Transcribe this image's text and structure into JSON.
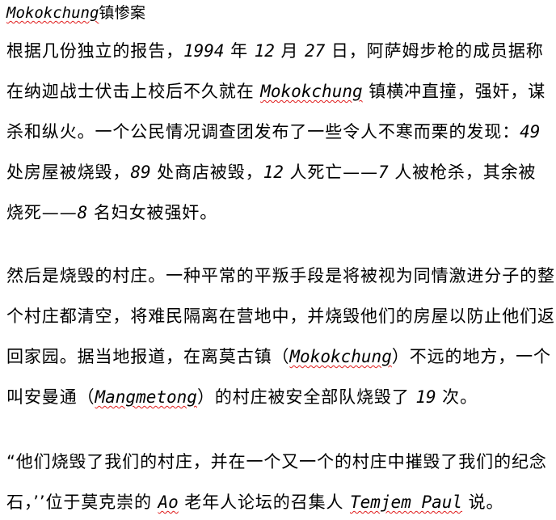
{
  "title": {
    "word": "Mokokchung",
    "rest": "镇惨案"
  },
  "p1": {
    "l1a": "根据几份独立的报告，",
    "l1b": "1994",
    "l1c": " 年 ",
    "l1d": "12",
    "l1e": " 月 ",
    "l1f": "27",
    "l1g": " 日，阿萨姆步枪的成员据称",
    "l2a": "在纳迦战士伏击上校后不久就在 ",
    "l2b": "Mokokchung",
    "l2c": " 镇横冲直撞，强奸，谋",
    "l3a": "杀和纵火。一个公民情况调查团发布了一些令人不寒而栗的发现：",
    "l3b": "49",
    "l4a": "处房屋被烧毁，",
    "l4b": "89",
    "l4c": " 处商店被毁，",
    "l4d": "12",
    "l4e": " 人死亡——",
    "l4f": "7",
    "l4g": " 人被枪杀，其余被",
    "l5a": "烧死——",
    "l5b": "8",
    "l5c": " 名妇女被强奸。"
  },
  "p2": {
    "l1": "然后是烧毁的村庄。一种平常的平叛手段是将被视为同情激进分子的整",
    "l2": "个村庄都清空，将难民隔离在营地中，并烧毁他们的房屋以防止他们返",
    "l3a": "回家园。据当地报道，在离莫古镇（",
    "l3b": "Mokokchung",
    "l3c": "）不远的地方，一个",
    "l4a": "叫安曼通（",
    "l4b": "Mangmetong",
    "l4c": "）的村庄被安全部队烧毁了 ",
    "l4d": "19",
    "l4e": " 次。"
  },
  "p3": {
    "l1": "“他们烧毁了我们的村庄，并在一个又一个的村庄中摧毁了我们的纪念",
    "l2a": "石，’’位于莫克崇的 ",
    "l2b": "Ao",
    "l2c": " 老年人论坛的召集人 ",
    "l2d": "Temjem Paul",
    "l2e": " 说。"
  },
  "colors": {
    "text": "#000000",
    "spellcheck_underline": "#e01b1b",
    "background": "#ffffff"
  }
}
